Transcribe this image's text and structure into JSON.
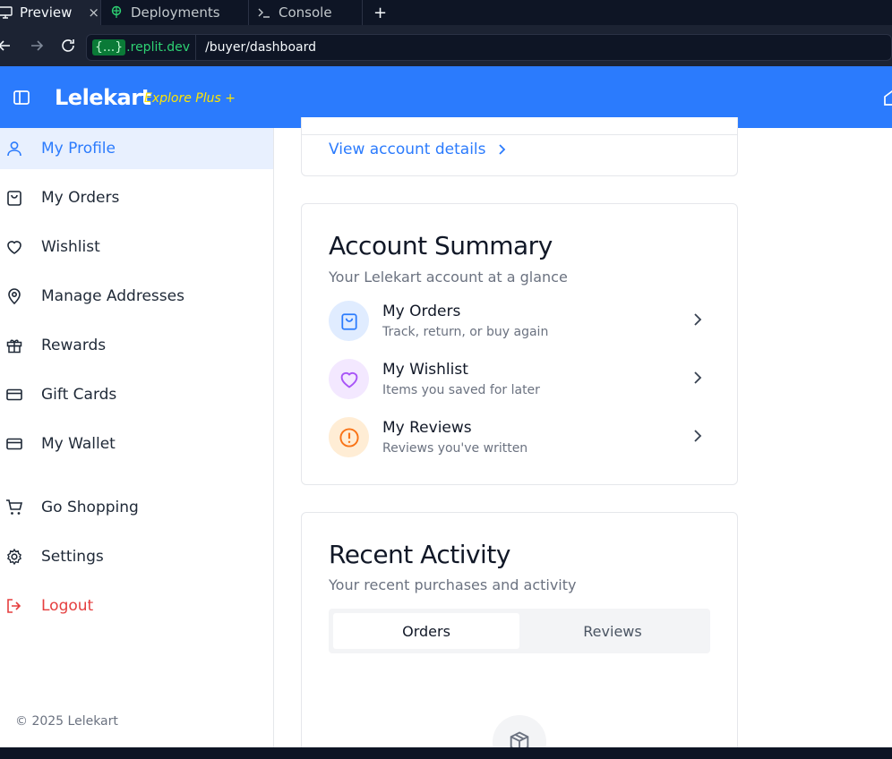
{
  "browser": {
    "tabs": [
      {
        "label": "Preview",
        "close": "×"
      },
      {
        "label": "Deployments"
      },
      {
        "label": "Console"
      }
    ],
    "new_tab": "+",
    "url_domain_brace": "{...}",
    "url_domain": ".replit.dev",
    "url_path": "/buyer/dashboard"
  },
  "header": {
    "brand": "Lelekart",
    "brand_sub": "Explore Plus +"
  },
  "sidebar": {
    "items": [
      {
        "label": "My Profile",
        "icon": "user-icon"
      },
      {
        "label": "My Orders",
        "icon": "shopping-bag-icon"
      },
      {
        "label": "Wishlist",
        "icon": "heart-icon"
      },
      {
        "label": "Manage Addresses",
        "icon": "map-pin-icon"
      },
      {
        "label": "Rewards",
        "icon": "gift-icon"
      },
      {
        "label": "Gift Cards",
        "icon": "credit-card-icon"
      },
      {
        "label": "My Wallet",
        "icon": "wallet-icon"
      },
      {
        "label": "Go Shopping",
        "icon": "cart-icon"
      },
      {
        "label": "Settings",
        "icon": "gear-icon"
      },
      {
        "label": "Logout",
        "icon": "logout-icon"
      }
    ],
    "copyright": "© 2025 Lelekart"
  },
  "profile_card": {
    "view_details": "View account details"
  },
  "summary": {
    "title": "Account Summary",
    "subtitle": "Your Lelekart account at a glance",
    "items": [
      {
        "title": "My Orders",
        "desc": "Track, return, or buy again",
        "icon": "shopping-bag-icon",
        "color": "#2b7bfd"
      },
      {
        "title": "My Wishlist",
        "desc": "Items you saved for later",
        "icon": "heart-icon",
        "color": "#a855f7"
      },
      {
        "title": "My Reviews",
        "desc": "Reviews you've written",
        "icon": "alert-circle-icon",
        "color": "#f97316"
      }
    ]
  },
  "activity": {
    "title": "Recent Activity",
    "subtitle": "Your recent purchases and activity",
    "tabs": [
      "Orders",
      "Reviews"
    ],
    "empty_icon": "package-icon"
  },
  "colors": {
    "primary": "#2b7bfd",
    "brand_accent": "#ffe500",
    "danger": "#e53e3e"
  }
}
